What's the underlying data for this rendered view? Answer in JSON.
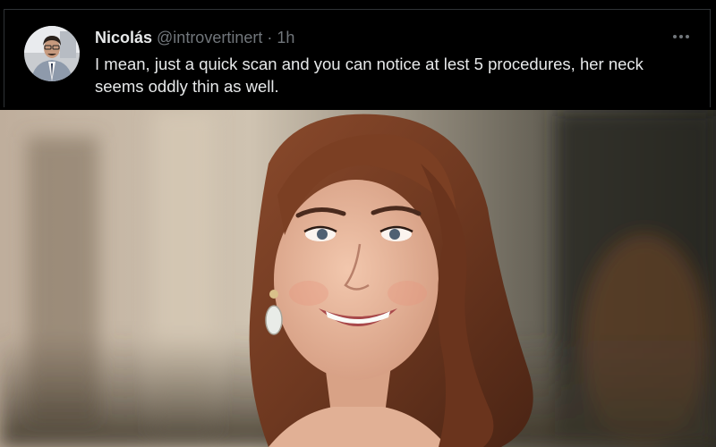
{
  "tweet": {
    "display_name": "Nicolás",
    "handle": "@introvertinert",
    "separator": "·",
    "timestamp": "1h",
    "text": "I mean, just a quick scan and you can notice at lest 5 procedures, her neck seems oddly thin as well."
  },
  "icons": {
    "avatar": "avatar-photo",
    "more": "more-horizontal-icon"
  },
  "colors": {
    "background": "#000000",
    "primary_text": "#e7e9ea",
    "secondary_text": "#71767b",
    "border": "#2f3336"
  }
}
